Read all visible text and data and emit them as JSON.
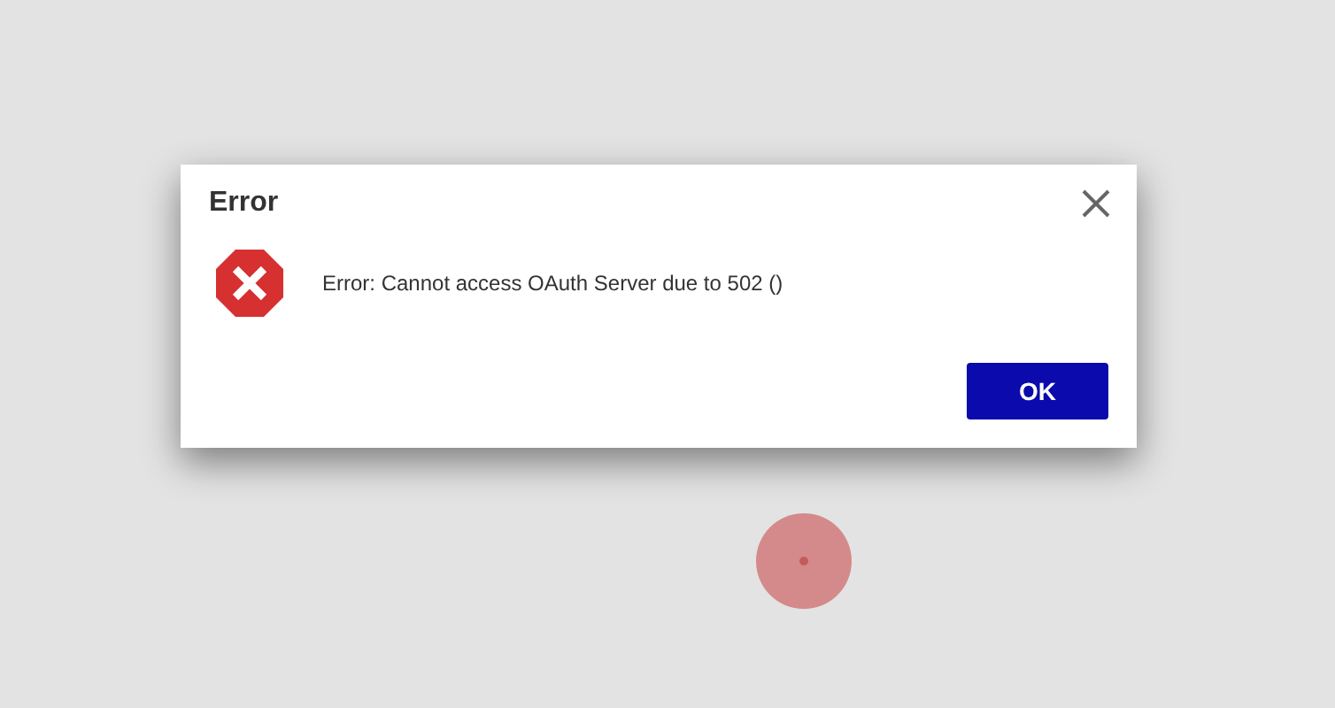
{
  "dialog": {
    "title": "Error",
    "message": "Error: Cannot access OAuth Server due to 502 ()",
    "buttons": [
      "OK"
    ]
  }
}
